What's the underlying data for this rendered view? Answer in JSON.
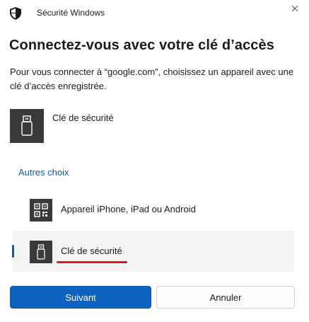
{
  "window": {
    "title": "Sécurité Windows",
    "close_icon": "close-icon"
  },
  "dialog": {
    "heading": "Connectez-vous avec votre clé d’accès",
    "description": "Pour vous connecter à “google.com”, choisissez un appareil avec une clé d’accès enregistrée."
  },
  "primary_option": {
    "label": "Clé de sécurité",
    "icon": "usb-key-icon"
  },
  "more_choices": {
    "label": "Autres choix",
    "items": [
      {
        "label": "Appareil iPhone, iPad ou Android",
        "icon": "qr-code-icon",
        "selected": false
      },
      {
        "label": "Clé de sécurité",
        "icon": "usb-key-icon",
        "selected": true
      }
    ]
  },
  "buttons": {
    "next": "Suivant",
    "cancel": "Annuler"
  },
  "colors": {
    "accent": "#0f63c0",
    "link": "#0a5bb0",
    "highlight_underline": "#d62020",
    "tile": "#3a3a3a"
  }
}
